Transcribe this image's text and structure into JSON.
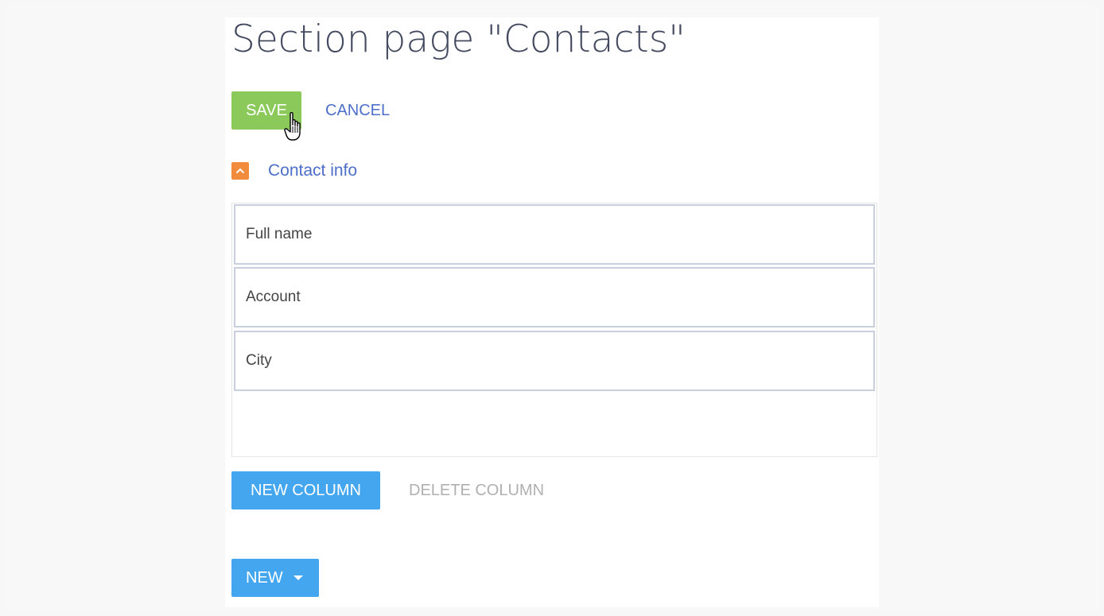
{
  "page": {
    "title": "Section page \"Contacts\""
  },
  "toolbar": {
    "save_label": "SAVE",
    "cancel_label": "CANCEL"
  },
  "group": {
    "label": "Contact info",
    "expanded": true,
    "icon": "chevron-up-icon"
  },
  "fields": [
    {
      "label": "Full name"
    },
    {
      "label": "Account"
    },
    {
      "label": "City"
    }
  ],
  "column_actions": {
    "new_column_label": "NEW COLUMN",
    "delete_column_label": "DELETE COLUMN"
  },
  "new_button": {
    "label": "NEW",
    "icon": "caret-down-icon"
  },
  "colors": {
    "save": "#8bc95a",
    "primary": "#44a6ee",
    "link": "#4d6fc9",
    "toggle": "#f08c3c",
    "disabled": "#b0b0b0"
  },
  "cursor": "hand-pointer-icon"
}
